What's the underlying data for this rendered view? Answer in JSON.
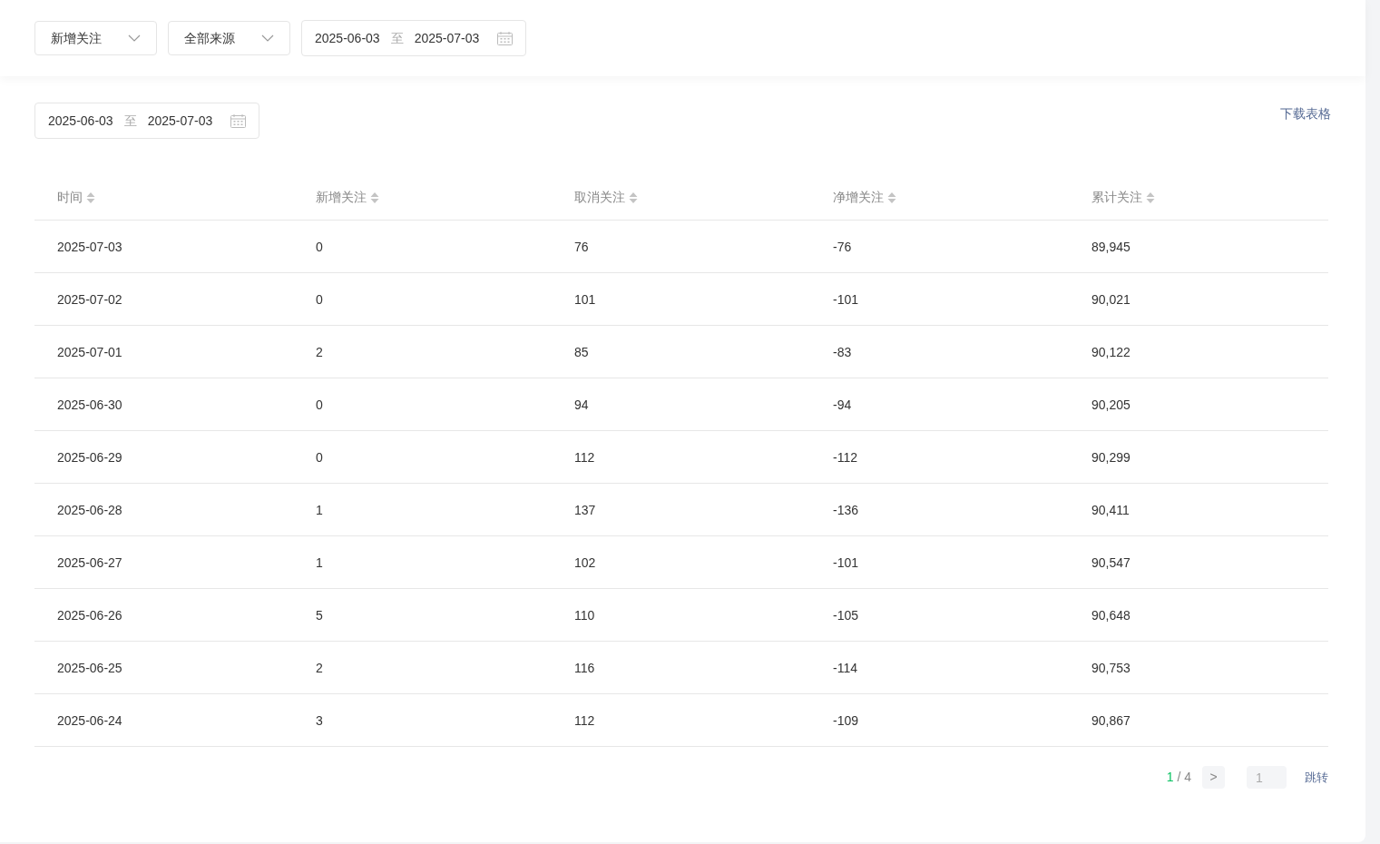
{
  "filters": {
    "metric": "新增关注",
    "source": "全部来源",
    "date_range": {
      "start": "2025-06-03",
      "separator": "至",
      "end": "2025-07-03"
    }
  },
  "table_section": {
    "date_range": {
      "start": "2025-06-03",
      "separator": "至",
      "end": "2025-07-03"
    },
    "download_link": "下载表格",
    "columns": [
      "时间",
      "新增关注",
      "取消关注",
      "净增关注",
      "累计关注"
    ],
    "rows": [
      {
        "cells": [
          "2025-07-03",
          "0",
          "76",
          "-76",
          "89,945"
        ]
      },
      {
        "cells": [
          "2025-07-02",
          "0",
          "101",
          "-101",
          "90,021"
        ]
      },
      {
        "cells": [
          "2025-07-01",
          "2",
          "85",
          "-83",
          "90,122"
        ]
      },
      {
        "cells": [
          "2025-06-30",
          "0",
          "94",
          "-94",
          "90,205"
        ]
      },
      {
        "cells": [
          "2025-06-29",
          "0",
          "112",
          "-112",
          "90,299"
        ]
      },
      {
        "cells": [
          "2025-06-28",
          "1",
          "137",
          "-136",
          "90,411"
        ]
      },
      {
        "cells": [
          "2025-06-27",
          "1",
          "102",
          "-101",
          "90,547"
        ]
      },
      {
        "cells": [
          "2025-06-26",
          "5",
          "110",
          "-105",
          "90,648"
        ]
      },
      {
        "cells": [
          "2025-06-25",
          "2",
          "116",
          "-114",
          "90,753"
        ]
      },
      {
        "cells": [
          "2025-06-24",
          "3",
          "112",
          "-109",
          "90,867"
        ]
      }
    ],
    "pagination": {
      "current": "1",
      "separator": "/",
      "total": "4",
      "next": ">",
      "jump_input": "1",
      "jump_button": "跳转"
    }
  }
}
